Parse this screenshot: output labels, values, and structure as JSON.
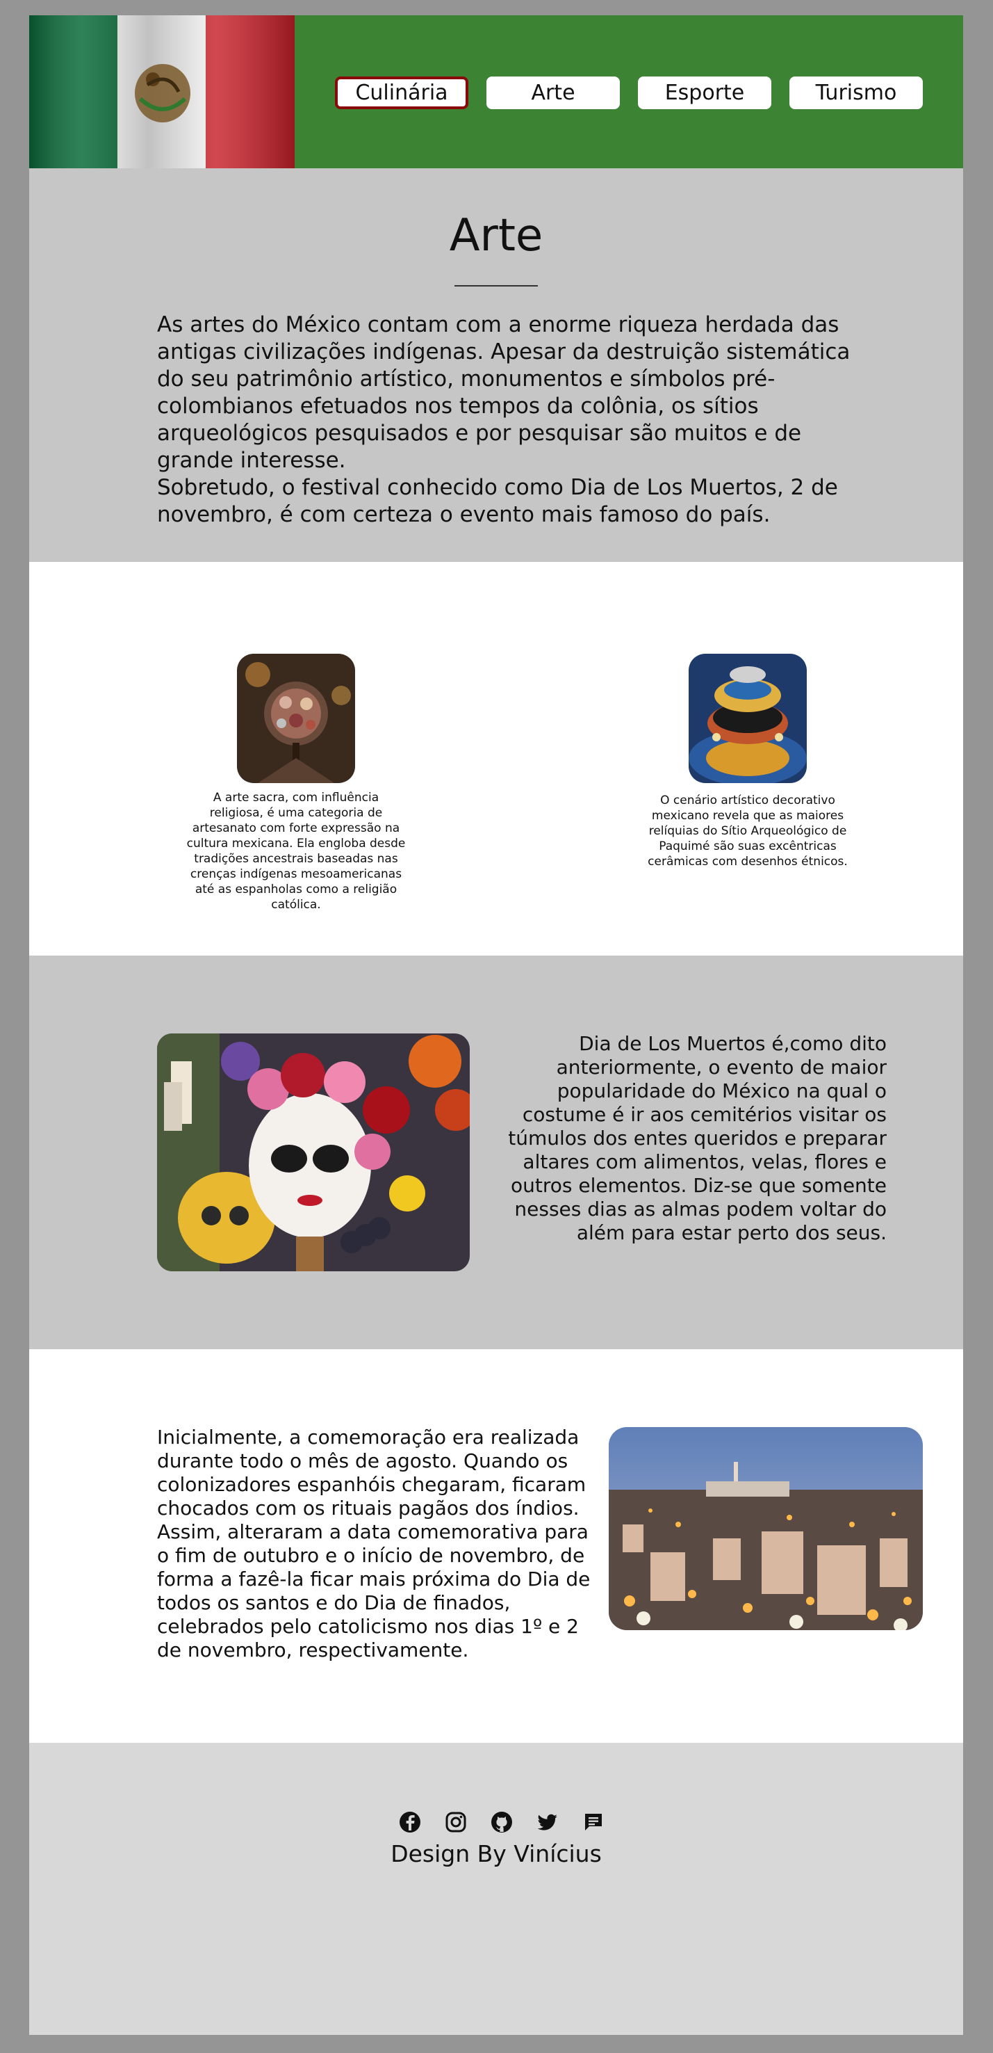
{
  "nav": {
    "items": [
      {
        "label": "Culinária",
        "active": true
      },
      {
        "label": "Arte",
        "active": false
      },
      {
        "label": "Esporte",
        "active": false
      },
      {
        "label": "Turismo",
        "active": false
      }
    ]
  },
  "intro": {
    "title": "Arte",
    "paragraph_1": "As artes do México contam com a enorme riqueza herdada das antigas civilizações indígenas. Apesar da destruição sistemática do seu patrimônio artístico, monumentos e símbolos pré-colombianos efetuados nos tempos da colônia, os sítios arqueológicos pesquisados e por pesquisar são muitos e de grande interesse.",
    "paragraph_2": "Sobretudo, o festival conhecido como Dia de Los Muertos, 2 de novembro, é com certeza o evento mais famoso do país."
  },
  "cards": [
    {
      "caption": "A arte sacra, com influência religiosa, é uma categoria de artesanato com forte expressão na cultura mexicana. Ela engloba desde tradições ancestrais baseadas nas crenças indígenas mesoamericanas até as espanholas como a religião católica."
    },
    {
      "caption": "O cenário artístico decorativo mexicano revela que as maiores relíquias do Sítio Arqueológico de Paquimé são suas excêntricas cerâmicas com desenhos étnicos."
    }
  ],
  "dia": {
    "text": "Dia de Los Muertos é,como dito anteriormente, o evento de maior popularidade do México  na qual o costume é ir aos cemitérios visitar os túmulos dos entes queridos e preparar altares com alimentos, velas, flores e outros elementos. Diz-se que somente nesses dias as almas podem voltar do além para estar perto dos seus."
  },
  "history": {
    "text": "Inicialmente, a comemoração era realizada durante todo o mês de agosto. Quando os colonizadores espanhóis chegaram, ficaram chocados com os rituais pagãos dos índios. Assim, alteraram a data comemorativa para o fim de outubro e o início de novembro, de forma a fazê-la ficar mais próxima do Dia de todos os santos e do Dia de finados, celebrados pelo catolicismo nos dias 1º e 2 de novembro, respectivamente."
  },
  "footer": {
    "icons": [
      "facebook-icon",
      "instagram-icon",
      "github-icon",
      "twitter-icon",
      "chat-icon"
    ],
    "credit": "Design By Vinícius"
  },
  "colors": {
    "header_green": "#3c8434",
    "active_border": "#8a0a0a",
    "section_gray": "#c6c6c6",
    "footer_gray": "#d8d8d8",
    "outer_gray": "#959595"
  }
}
